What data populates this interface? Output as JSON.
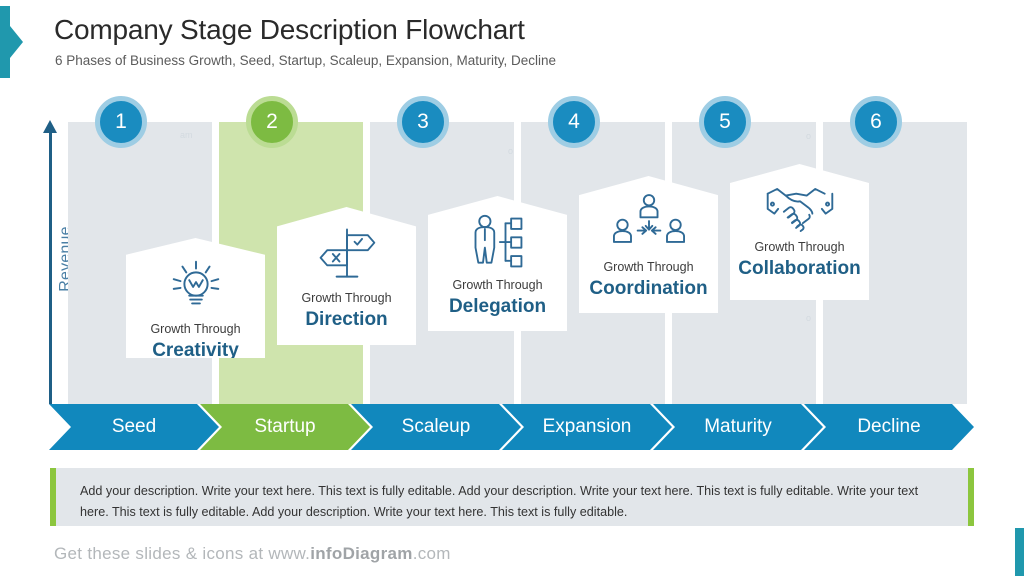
{
  "header": {
    "title": "Company Stage Description Flowchart",
    "subtitle": "6 Phases of Business Growth, Seed, Startup, Scaleup, Expansion, Maturity, Decline"
  },
  "axis": {
    "y_label": "Revenue"
  },
  "colors": {
    "blue": "#1188bd",
    "dark_blue": "#1f5f86",
    "green": "#7dbb42",
    "light_green": "#cfe4ad",
    "gray": "#e2e6ea",
    "teal": "#2098ad",
    "desc_bar_green": "#8cc63e"
  },
  "stages": [
    {
      "number": "1",
      "ribbon_label": "Seed",
      "card_sub": "Growth Through",
      "card_main": "Creativity",
      "icon": "lightbulb-icon",
      "highlight": false
    },
    {
      "number": "2",
      "ribbon_label": "Startup",
      "card_sub": "Growth Through",
      "card_main": "Direction",
      "icon": "signpost-icon",
      "highlight": true
    },
    {
      "number": "3",
      "ribbon_label": "Scaleup",
      "card_sub": "Growth Through",
      "card_main": "Delegation",
      "icon": "org-chart-person-icon",
      "highlight": false
    },
    {
      "number": "4",
      "ribbon_label": "Expansion",
      "card_sub": "Growth Through",
      "card_main": "Coordination",
      "icon": "three-people-converging-icon",
      "highlight": false
    },
    {
      "number": "5",
      "ribbon_label": "Maturity",
      "card_sub": "Growth Through",
      "card_main": "Collaboration",
      "icon": "handshake-icon",
      "highlight": false
    },
    {
      "number": "6",
      "ribbon_label": "Decline",
      "card_sub": "",
      "card_main": "",
      "icon": "",
      "highlight": false
    }
  ],
  "description": {
    "text": "Add your description. Write your text here. This text is fully editable.  Add your description. Write your text here. This text is fully editable. Write your text here. This text is fully editable. Add your description. Write your text here. This text is fully editable."
  },
  "footer": {
    "prefix": "Get these slides & icons at www.",
    "brand": "infoDiagram",
    "suffix": ".com"
  }
}
